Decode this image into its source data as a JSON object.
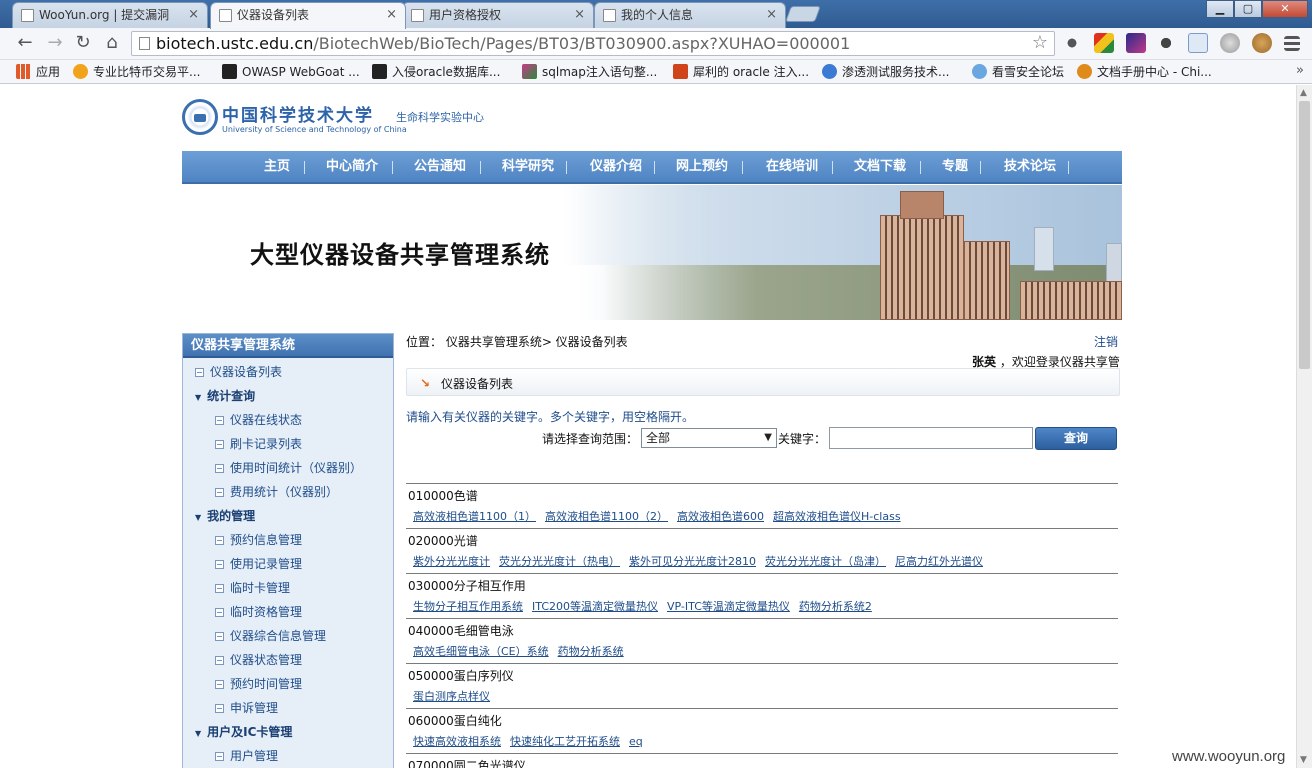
{
  "browser": {
    "tabs": [
      {
        "label": "WooYun.org | 提交漏洞",
        "active": false
      },
      {
        "label": "仪器设备列表",
        "active": true
      },
      {
        "label": "用户资格授权",
        "active": false
      },
      {
        "label": "我的个人信息",
        "active": false
      }
    ],
    "close_glyph": "×",
    "url_host": "biotech.ustc.edu.cn",
    "url_path": "/BiotechWeb/BioTech/Pages/BT03/BT030900.aspx?XUHAO=000001",
    "bookmarks": [
      {
        "label": "应用",
        "color": "#e05a2a"
      },
      {
        "label": "专业比特币交易平...",
        "color": "#f2a31c"
      },
      {
        "label": "OWASP WebGoat ...",
        "color": "#222222"
      },
      {
        "label": "入侵oracle数据库...",
        "color": "#222222"
      },
      {
        "label": "sqlmap注入语句整...",
        "color": "#c83a8a"
      },
      {
        "label": "犀利的 oracle 注入...",
        "color": "#d0441c"
      },
      {
        "label": "渗透测试服务技术...",
        "color": "#3b7bd4"
      },
      {
        "label": "看雪安全论坛",
        "color": "#6aa6e0"
      },
      {
        "label": "文档手册中心 - Chi...",
        "color": "#e08a1c"
      }
    ],
    "bookmarks_more": "»"
  },
  "site": {
    "logo_cn": "中国科学技术大学",
    "logo_en": "University of Science and Technology of China",
    "logo_dept": "生命科学实验中心",
    "nav": [
      "主页",
      "中心简介",
      "公告通知",
      "科学研究",
      "仪器介绍",
      "网上预约",
      "在线培训",
      "文档下载",
      "专题",
      "技术论坛"
    ],
    "banner_title": "大型仪器设备共享管理系统"
  },
  "sidebar": {
    "title": "仪器共享管理系统",
    "items": [
      {
        "label": "仪器设备列表",
        "type": "leaf",
        "indent": 0
      },
      {
        "label": "统计查询",
        "type": "group"
      },
      {
        "label": "仪器在线状态",
        "type": "leaf",
        "indent": 1
      },
      {
        "label": "刷卡记录列表",
        "type": "leaf",
        "indent": 1
      },
      {
        "label": "使用时间统计（仪器别）",
        "type": "leaf",
        "indent": 1
      },
      {
        "label": "费用统计（仪器别）",
        "type": "leaf",
        "indent": 1
      },
      {
        "label": "我的管理",
        "type": "group"
      },
      {
        "label": "预约信息管理",
        "type": "leaf",
        "indent": 1
      },
      {
        "label": "使用记录管理",
        "type": "leaf",
        "indent": 1
      },
      {
        "label": "临时卡管理",
        "type": "leaf",
        "indent": 1
      },
      {
        "label": "临时资格管理",
        "type": "leaf",
        "indent": 1
      },
      {
        "label": "仪器综合信息管理",
        "type": "leaf",
        "indent": 1
      },
      {
        "label": "仪器状态管理",
        "type": "leaf",
        "indent": 1
      },
      {
        "label": "预约时间管理",
        "type": "leaf",
        "indent": 1
      },
      {
        "label": "申诉管理",
        "type": "leaf",
        "indent": 1
      },
      {
        "label": "用户及IC卡管理",
        "type": "group"
      },
      {
        "label": "用户管理",
        "type": "leaf",
        "indent": 1
      }
    ]
  },
  "content": {
    "breadcrumb": "位置：  仪器共享管理系统> 仪器设备列表",
    "logout": "注销",
    "user_name": "张英",
    "welcome_text": " ，欢迎登录仪器共享管理系统",
    "section_title": "仪器设备列表",
    "hint": "请输入有关仪器的关键字。多个关键字，用空格隔开。",
    "scope_label": "请选择查询范围：",
    "scope_value": "全部",
    "keyword_label": "关键字：",
    "keyword_value": "",
    "query_button": "查询",
    "categories": [
      {
        "name": "010000色谱",
        "items": [
          "高效液相色谱1100（1）",
          "高效液相色谱1100（2）",
          "高效液相色谱600",
          "超高效液相色谱仪H-class"
        ]
      },
      {
        "name": "020000光谱",
        "items": [
          "紫外分光光度计",
          "荧光分光光度计（热电）",
          "紫外可见分光光度计2810",
          "荧光分光光度计（岛津）",
          "尼高力红外光谱仪"
        ]
      },
      {
        "name": "030000分子相互作用",
        "items": [
          "生物分子相互作用系统",
          "ITC200等温滴定微量热仪",
          "VP-ITC等温滴定微量热仪",
          "药物分析系统2"
        ]
      },
      {
        "name": "040000毛细管电泳",
        "items": [
          "高效毛细管电泳（CE）系统",
          "药物分析系统"
        ]
      },
      {
        "name": "050000蛋白序列仪",
        "items": [
          "蛋白测序点样仪"
        ]
      },
      {
        "name": "060000蛋白纯化",
        "items": [
          "快速高效液相系统",
          "快速纯化工艺开拓系统",
          "eq"
        ]
      },
      {
        "name": "070000圆二色光谱仪",
        "items": []
      }
    ]
  },
  "watermark": "www.wooyun.org"
}
